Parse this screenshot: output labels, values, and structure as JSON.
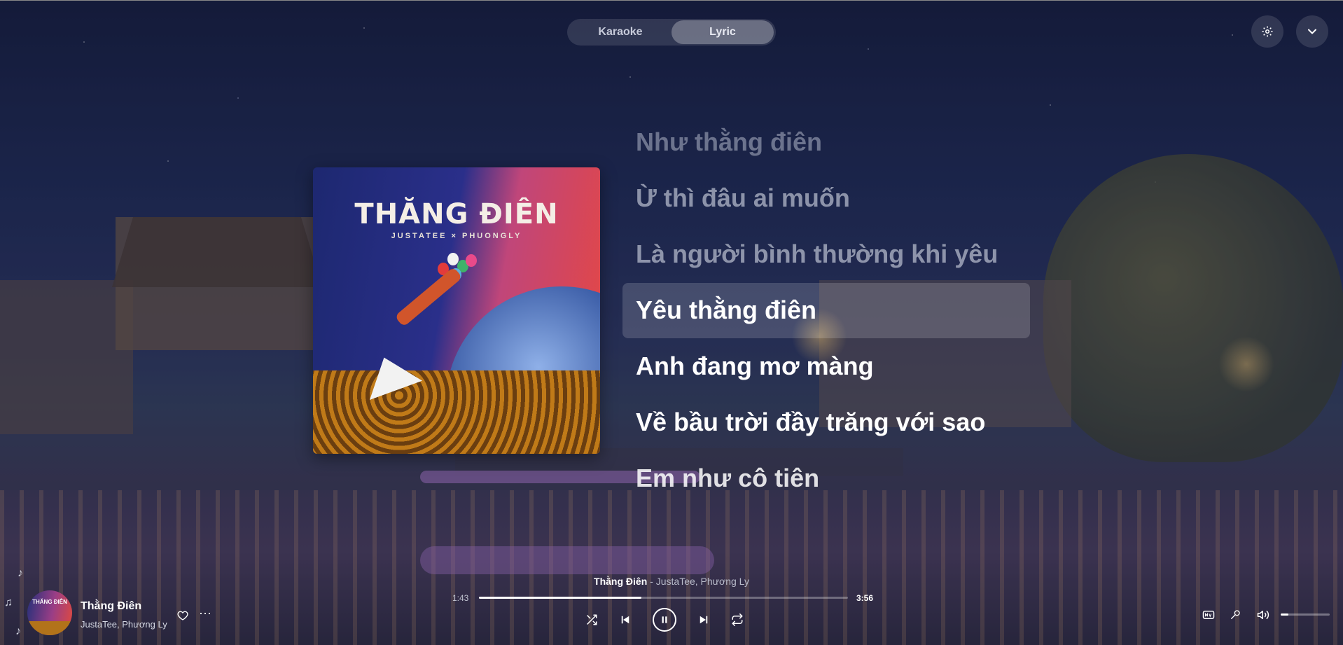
{
  "tabs": [
    {
      "label": "Karaoke",
      "active": false
    },
    {
      "label": "Lyric",
      "active": true
    }
  ],
  "top_controls": {
    "settings_icon": "gear-icon",
    "collapse_icon": "chevron-down-icon"
  },
  "album": {
    "title": "THĂNG ĐIÊN",
    "subtitle": "JUSTATEE  ×  PHUONGLY"
  },
  "lyrics": [
    {
      "text": "Như thằng điên",
      "state": "past"
    },
    {
      "text": "Ừ thì đâu ai muốn",
      "state": "past"
    },
    {
      "text": "Là người bình thường khi yêu",
      "state": "past"
    },
    {
      "text": "Yêu thằng điên",
      "state": "current"
    },
    {
      "text": "Anh đang mơ màng",
      "state": "next"
    },
    {
      "text": "Về bầu trời đầy trăng với sao",
      "state": "next"
    },
    {
      "text": "Em như cô tiên",
      "state": "next"
    }
  ],
  "player": {
    "song_title": "Thằng Điên",
    "song_artist": "JustaTee, Phương Ly",
    "now_playing_title": "Thằng Điên",
    "now_playing_separator": " - ",
    "now_playing_artist": "JustaTee, Phương Ly",
    "current_time": "1:43",
    "total_time": "3:56",
    "progress_fraction": 0.44,
    "volume_fraction": 0.15,
    "state": "playing",
    "more_label": "···"
  },
  "colors": {
    "accent": "#ffffff",
    "tab_active_bg": "rgba(255,255,255,0.28)",
    "lyric_highlight_bg": "rgba(255,255,255,0.16)"
  }
}
